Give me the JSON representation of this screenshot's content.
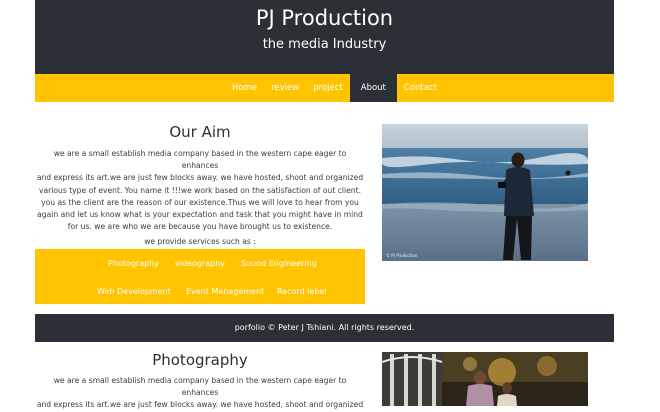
{
  "header": {
    "title": "PJ Production",
    "subtitle": "the media Industry"
  },
  "nav": {
    "items": [
      "Home",
      "review",
      "project",
      "About",
      "Contact"
    ],
    "active_index": 3
  },
  "about": {
    "heading": "Our Aim",
    "lines": [
      "we are a small establish media company based in the western cape eager to enhances",
      "and express its art.we are just few blocks away. we have hosted, shoot and organized",
      "various type of event. You name it !!!we work based on the satisfaction of out client.",
      "you as the client are the reason of our existence.Thus we will love to hear from you",
      "again and let us know what is your expectation and task that you might have in mind",
      "for us. we are who we are because you have brought us to existence."
    ],
    "services_label": "we provide services such as :",
    "services": [
      "Photography",
      "videography",
      "Sound Engineering",
      "Web Development",
      "Event Management",
      "Record lebel"
    ],
    "image_caption": "© PJ Production"
  },
  "footer": {
    "text": "porfolio © Peter J Tshiani. All rights reserved."
  },
  "photography": {
    "heading": "Photography",
    "lines": [
      "we are a small establish media company based in the western cape eager to enhances",
      "and express its art.we are just few blocks away. we have hosted, shoot and organized"
    ]
  },
  "colors": {
    "dark": "#2b2f36",
    "accent": "#ffc300"
  }
}
